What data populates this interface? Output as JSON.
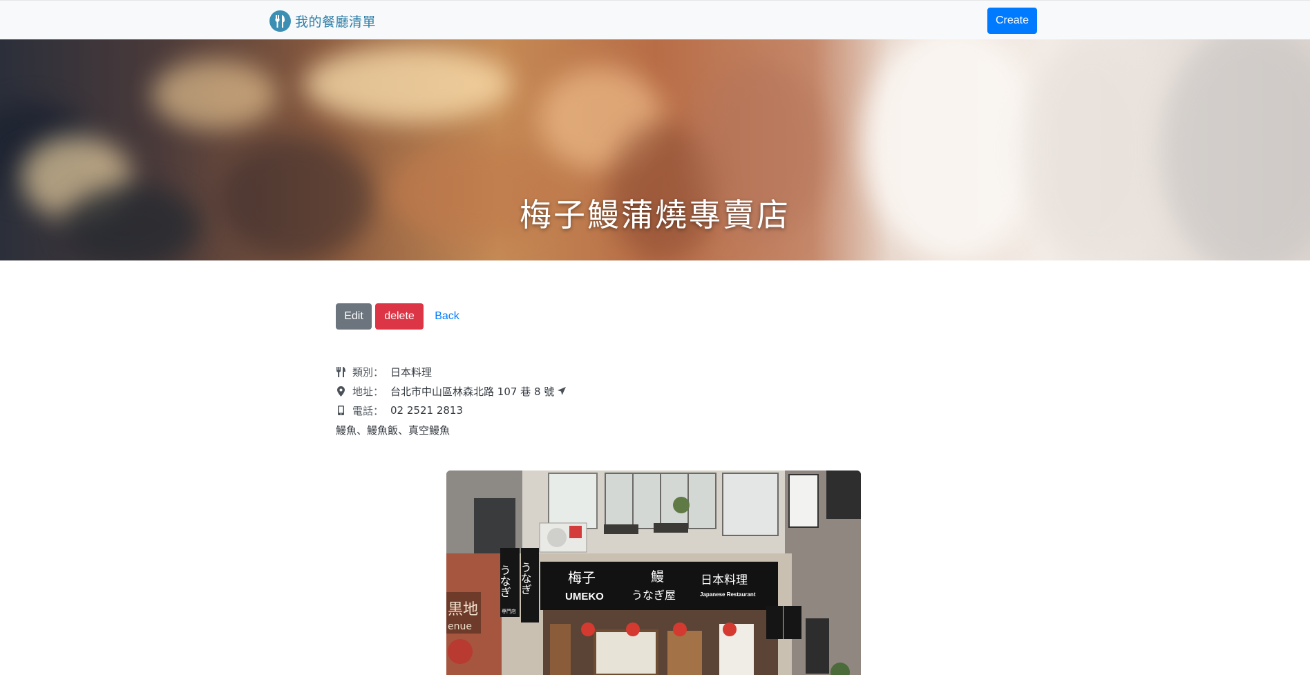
{
  "nav": {
    "brand": "我的餐廳清單",
    "create_label": "Create"
  },
  "restaurant": {
    "name": "梅子鰻蒲燒專賣店",
    "category_label": "類別：",
    "category": "日本料理",
    "address_label": "地址：",
    "address": "台北市中山區林森北路 107 巷 8 號",
    "phone_label": "電話：",
    "phone": "02 2521 2813",
    "description": "鰻魚、鰻魚飯、真空鰻魚"
  },
  "actions": {
    "edit_label": "Edit",
    "delete_label": "delete",
    "back_label": "Back"
  },
  "storefront_signs": {
    "main_name": "梅子",
    "main_romaji": "UMEKO",
    "eel_kanji": "鰻",
    "eel_kana": "うなぎ屋",
    "cuisine": "日本料理",
    "cuisine_en": "Japanese Restaurant",
    "side_sign": "うなぎ",
    "side_sign_2": "うなぎ",
    "side_small": "専門店",
    "left_partial": "黒地",
    "left_partial_en": "enue"
  },
  "icons": {
    "brand": "fork-knife-icon",
    "category": "utensils-icon",
    "address": "map-marker-icon",
    "directions": "location-arrow-icon",
    "phone": "mobile-icon"
  },
  "colors": {
    "primary": "#007bff",
    "secondary": "#6c757d",
    "danger": "#dc3545",
    "brand_text": "#2d7ea8",
    "navbar_bg": "#f8f9fa"
  }
}
